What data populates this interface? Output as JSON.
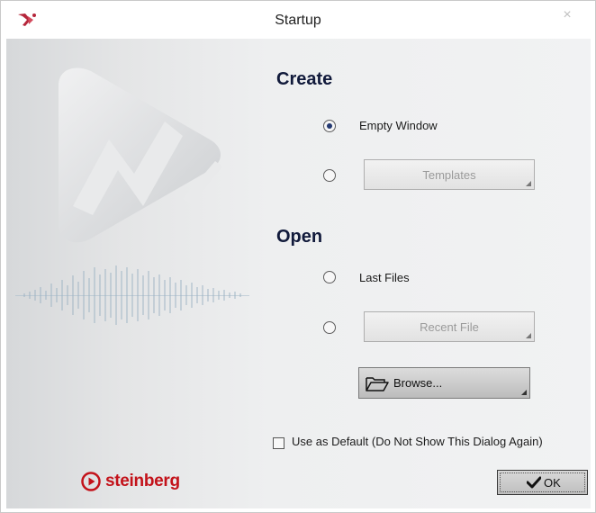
{
  "window": {
    "title": "Startup",
    "close_glyph": "×"
  },
  "create": {
    "heading": "Create",
    "empty_window": {
      "label": "Empty Window",
      "selected": true
    },
    "templates": {
      "label": "Templates",
      "selected": false
    }
  },
  "open": {
    "heading": "Open",
    "last_files": {
      "label": "Last Files",
      "selected": false
    },
    "recent_file": {
      "label": "Recent File",
      "selected": false
    },
    "browse": {
      "label": "Browse..."
    }
  },
  "default_checkbox": {
    "label": "Use as Default (Do Not Show This Dialog Again)",
    "checked": false
  },
  "brand": {
    "name": "steinberg",
    "color": "#c3121a"
  },
  "ok_button": {
    "label": "OK"
  },
  "icons": [
    "app-icon",
    "close-icon",
    "folder-icon",
    "checkmark-icon",
    "steinberg-logo-icon"
  ],
  "colors": {
    "heading": "#111a3b",
    "radio_dot": "#243a72"
  }
}
